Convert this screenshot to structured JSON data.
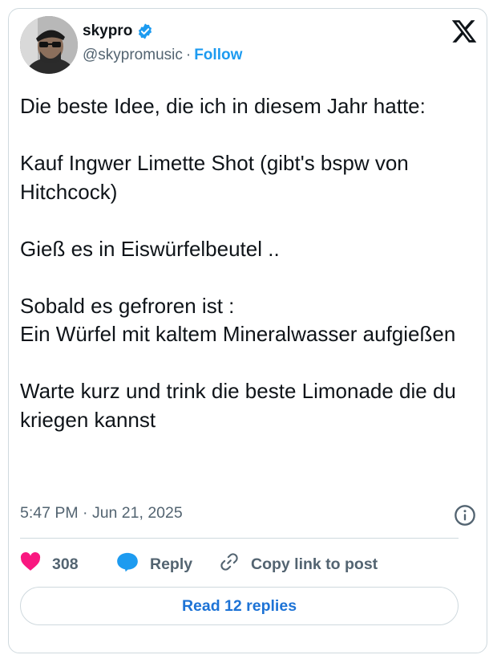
{
  "author": {
    "name": "skypro",
    "handle": "@skypromusic",
    "separator": "·",
    "follow_label": "Follow",
    "verified": true
  },
  "tweet": {
    "text": "Die beste Idee, die ich in diesem Jahr hatte:\n\nKauf Ingwer Limette Shot (gibt's bspw von Hitchcock)\n\nGieß es in Eiswürfelbeutel ..\n\nSobald es gefroren ist :\nEin Würfel mit kaltem Mineralwasser aufgießen\n\nWarte kurz und trink die beste Limonade die du kriegen kannst",
    "timestamp": "5:47 PM · Jun 21, 2025"
  },
  "actions": {
    "likes": "308",
    "reply_label": "Reply",
    "copy_label": "Copy link to post",
    "read_replies_label": "Read 12 replies"
  },
  "colors": {
    "accent": "#1d9bf0",
    "like": "#f91880",
    "text": "#0f1419",
    "muted": "#536471",
    "border": "#cfd9de"
  },
  "icons": [
    "x-logo-icon",
    "verified-badge-icon",
    "info-icon",
    "heart-icon",
    "reply-bubble-icon",
    "link-icon"
  ]
}
